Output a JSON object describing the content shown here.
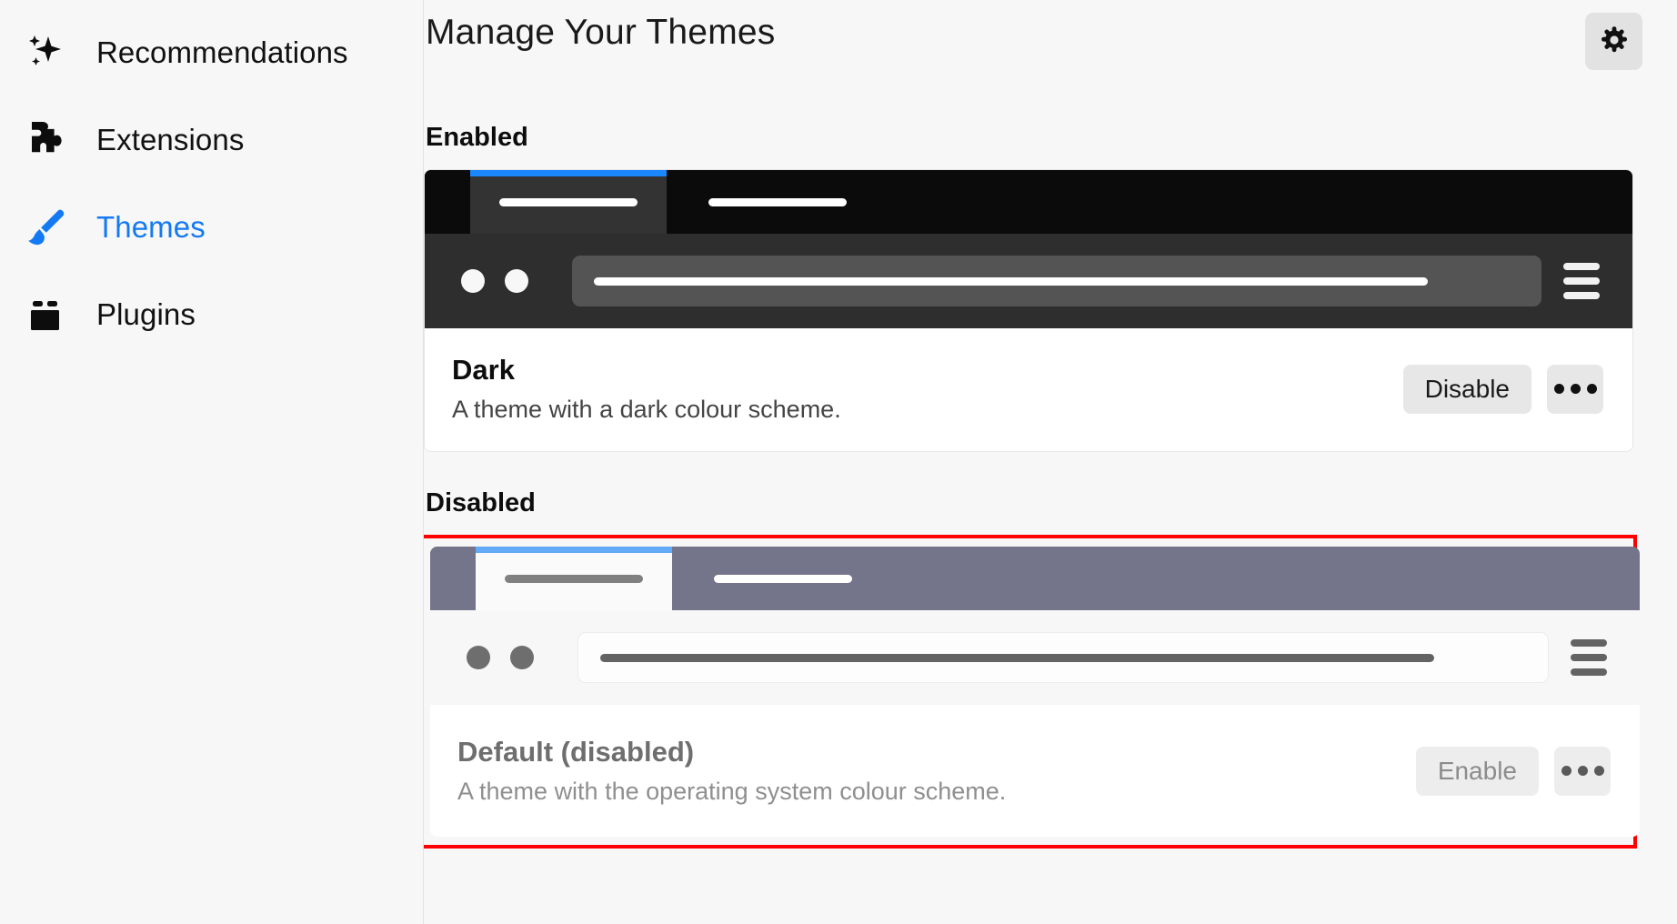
{
  "sidebar": {
    "items": [
      {
        "label": "Recommendations",
        "icon": "sparkle-icon",
        "active": false
      },
      {
        "label": "Extensions",
        "icon": "puzzle-piece-icon",
        "active": false
      },
      {
        "label": "Themes",
        "icon": "paintbrush-icon",
        "active": true
      },
      {
        "label": "Plugins",
        "icon": "plugin-box-icon",
        "active": false
      }
    ]
  },
  "header": {
    "title": "Manage Your Themes",
    "settings_icon": "gear-icon"
  },
  "sections": [
    {
      "title": "Enabled"
    },
    {
      "title": "Disabled"
    }
  ],
  "themes": {
    "enabled": {
      "name": "Dark",
      "description": "A theme with a dark colour scheme.",
      "action_label": "Disable",
      "more_icon": "ellipsis-icon",
      "highlighted": false,
      "preview": {
        "tabbar_bg": "#0b0b0b",
        "active_tab_bg": "#333333",
        "accent": "#1a86ff",
        "tab_line": "#ffffff",
        "toolbar_bg": "#2e2e2e",
        "dot": "#f7f7f7",
        "urlbar_bg": "#545454",
        "urlbar_line": "#ffffff",
        "hamburger": "#f2f2f2"
      }
    },
    "disabled": {
      "name": "Default (disabled)",
      "description": "A theme with the operating system colour scheme.",
      "action_label": "Enable",
      "more_icon": "ellipsis-icon",
      "highlighted": true,
      "highlight_color": "#ff0000",
      "preview": {
        "tabbar_bg": "#74748a",
        "active_tab_bg": "#fafafa",
        "accent": "#62aaf5",
        "tab_line": "#808080",
        "tab_rest_line": "#ffffff",
        "toolbar_bg": "#f7f7f7",
        "dot": "#6e6e6e",
        "urlbar_bg": "#fdfdfd",
        "urlbar_line": "#636363",
        "hamburger": "#636363"
      }
    }
  }
}
